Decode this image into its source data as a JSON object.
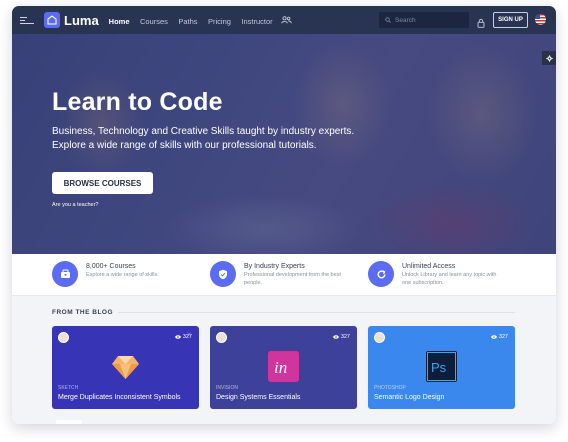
{
  "app": {
    "name": "Luma"
  },
  "nav": {
    "items": [
      {
        "label": "Home",
        "active": true
      },
      {
        "label": "Courses",
        "active": false
      },
      {
        "label": "Paths",
        "active": false
      },
      {
        "label": "Pricing",
        "active": false
      },
      {
        "label": "Instructor",
        "active": false
      }
    ]
  },
  "search": {
    "placeholder": "Search"
  },
  "header": {
    "signup_label": "SIGN UP"
  },
  "hero": {
    "title": "Learn to Code",
    "subtitle_line1": "Business, Technology and Creative Skills taught by industry experts.",
    "subtitle_line2": "Explore a wide range of skills with our professional tutorials.",
    "cta_label": "BROWSE COURSES",
    "teacher_link": "Are you a teacher?"
  },
  "features": [
    {
      "title": "8,000+ Courses",
      "desc": "Explore a wide range of skills.",
      "icon": "courses-icon"
    },
    {
      "title": "By Industry Experts",
      "desc": "Professional development from the best people.",
      "icon": "shield-check-icon"
    },
    {
      "title": "Unlimited Access",
      "desc": "Unlock Library and learn any topic with one subscription.",
      "icon": "refresh-icon"
    }
  ],
  "blog": {
    "section_title": "FROM THE BLOG",
    "cards": [
      {
        "category": "SKETCH",
        "title": "Merge Duplicates Inconsistent Symbols",
        "views": "327",
        "color": "#3834b6"
      },
      {
        "category": "INVISION",
        "title": "Design Systems Essentials",
        "views": "327",
        "color": "#3d4199"
      },
      {
        "category": "PHOTOSHOP",
        "title": "Semantic Logo Design",
        "views": "327",
        "color": "#3a87ee"
      }
    ]
  },
  "colors": {
    "accent": "#5b6cf3",
    "topbar": "#283452"
  }
}
